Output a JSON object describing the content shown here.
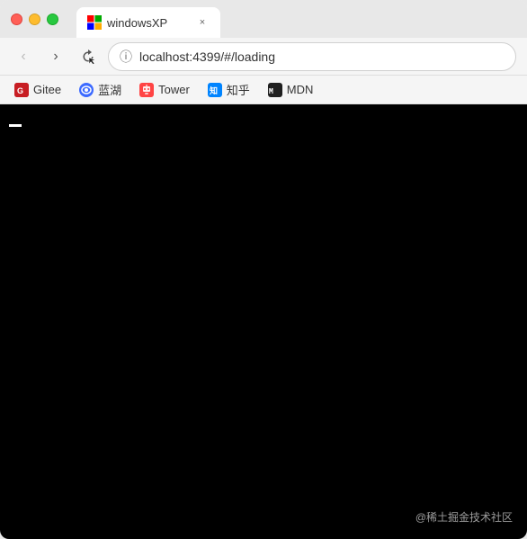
{
  "browser": {
    "title": "windowsXP",
    "tab": {
      "label": "windowsXP",
      "favicon": "XP"
    },
    "controls": {
      "close_label": "×",
      "minimize_label": "–",
      "maximize_label": "+"
    },
    "toolbar": {
      "back_label": "‹",
      "forward_label": "›",
      "reload_label": "↺",
      "address_info_icon": "ⓘ",
      "address_url": "localhost:4399/#/loading"
    },
    "bookmarks": [
      {
        "id": "gitee",
        "label": "Gitee",
        "icon_text": "G",
        "icon_bg": "#c71d23",
        "icon_color": "#fff"
      },
      {
        "id": "lanhu",
        "label": "蓝湖",
        "icon_text": "👁",
        "icon_bg": "#3c6aff",
        "icon_color": "#fff"
      },
      {
        "id": "tower",
        "label": "Tower",
        "icon_text": "🤖",
        "icon_bg": "#ff6b35",
        "icon_color": "#fff"
      },
      {
        "id": "zhihu",
        "label": "知乎",
        "icon_text": "知",
        "icon_bg": "#0084ff",
        "icon_color": "#fff"
      },
      {
        "id": "mdn",
        "label": "MDN",
        "icon_text": "M",
        "icon_bg": "#1f1f1f",
        "icon_color": "#fff"
      }
    ]
  },
  "page": {
    "background_color": "#000000",
    "watermark": "@稀土掘金技术社区"
  }
}
